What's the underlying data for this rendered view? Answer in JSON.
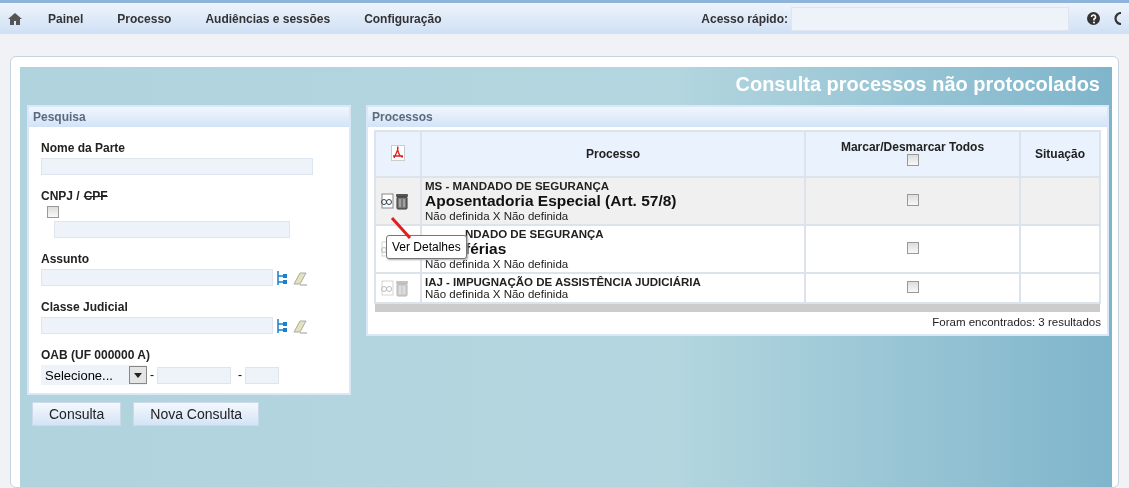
{
  "nav": {
    "items": [
      "Painel",
      "Processo",
      "Audiências e sessões",
      "Configuração"
    ],
    "quick_access": {
      "label": "Acesso rápido:"
    }
  },
  "page_title": "Consulta processos não protocolados",
  "search": {
    "title": "Pesquisa",
    "fields": [
      {
        "kind": "text",
        "label": "Nome da Parte"
      },
      {
        "kind": "doc",
        "label": "CNPJ /",
        "struck": "CPF",
        "checked": false
      },
      {
        "kind": "tree",
        "label": "Assunto"
      },
      {
        "kind": "tree",
        "label": "Classe Judicial"
      },
      {
        "kind": "oab",
        "label": "OAB (UF 000000 A)",
        "value": "Selecione...",
        "separators": [
          "-",
          "-"
        ]
      }
    ],
    "buttons": [
      "Consulta",
      "Nova Consulta"
    ]
  },
  "results": {
    "title": "Processos",
    "columns": [
      "Processo",
      "Marcar/Desmarcar Todos",
      "Situação"
    ],
    "all_checked": false,
    "rows": [
      {
        "class": "MS - MANDADO DE SEGURANÇA",
        "subject": "Aposentadoria Especial (Art. 57/8)",
        "parties": "Não definida X Não definida",
        "checked": false,
        "highlighted": true,
        "tooltip": "Ver Detalhes"
      },
      {
        "class": "NDADO DE SEGURANÇA",
        "subject": "férias",
        "parties": "Não definida X Não definida",
        "checked": false,
        "highlighted": false
      },
      {
        "class": "IAJ - IMPUGNAÇÃO DE ASSISTÊNCIA JUDICIÁRIA",
        "parties": "Não definida X Não definida",
        "checked": false,
        "highlighted": false
      }
    ],
    "footer": "Foram encontrados: 3 resultados"
  }
}
